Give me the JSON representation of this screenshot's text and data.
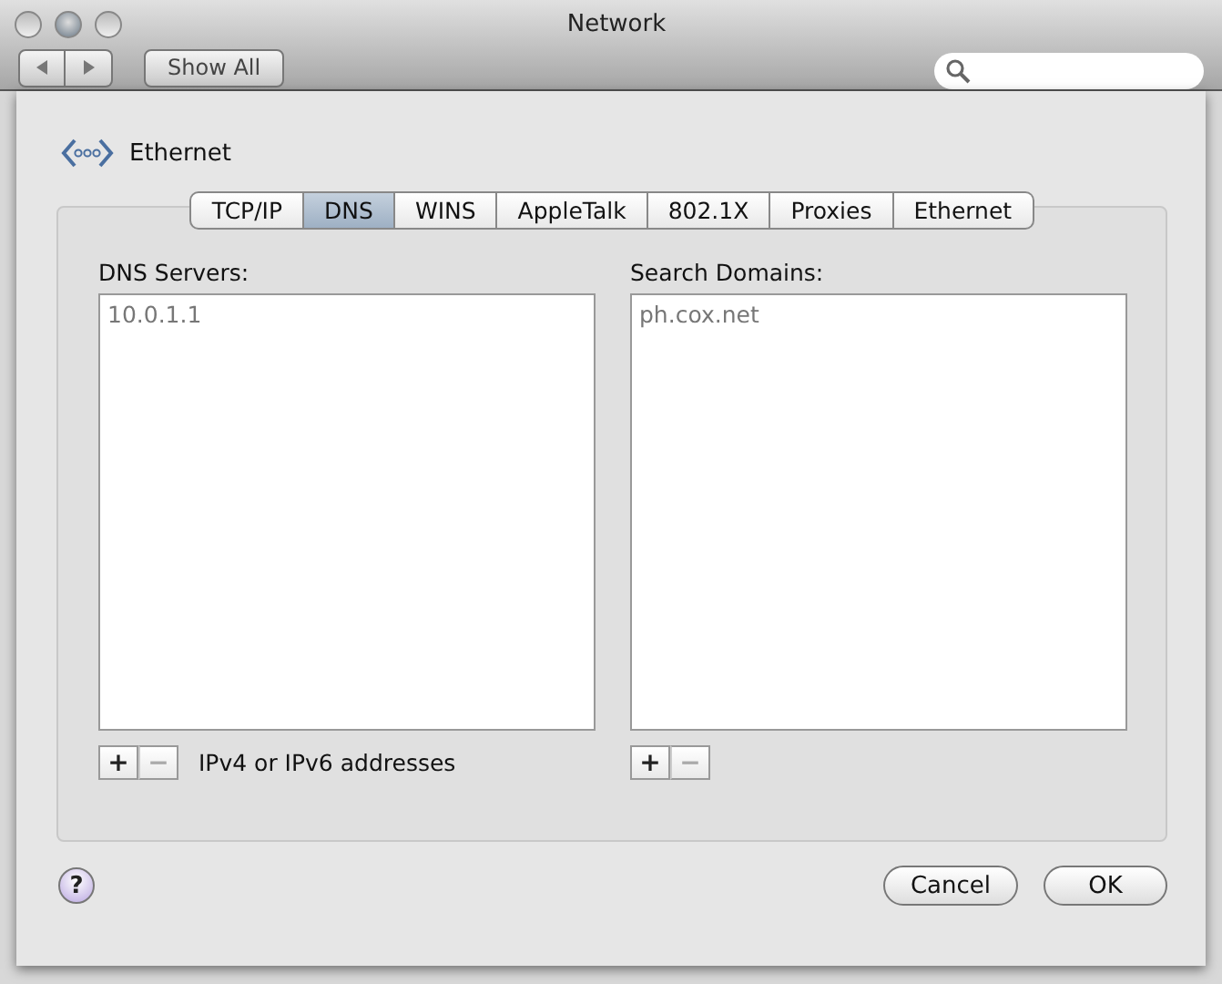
{
  "window": {
    "title": "Network"
  },
  "toolbar": {
    "show_all": "Show All"
  },
  "service": {
    "name": "Ethernet"
  },
  "tabs": [
    {
      "label": "TCP/IP",
      "selected": false
    },
    {
      "label": "DNS",
      "selected": true
    },
    {
      "label": "WINS",
      "selected": false
    },
    {
      "label": "AppleTalk",
      "selected": false
    },
    {
      "label": "802.1X",
      "selected": false
    },
    {
      "label": "Proxies",
      "selected": false
    },
    {
      "label": "Ethernet",
      "selected": false
    }
  ],
  "lists": [
    {
      "label": "DNS Servers:",
      "entries": [
        "10.0.1.1"
      ],
      "add": {
        "label": "+",
        "disabled": false
      },
      "remove": {
        "label": "−",
        "disabled": true
      },
      "hint": "IPv4 or IPv6 addresses"
    },
    {
      "label": "Search Domains:",
      "entries": [
        "ph.cox.net"
      ],
      "add": {
        "label": "+",
        "disabled": false
      },
      "remove": {
        "label": "−",
        "disabled": true
      }
    }
  ],
  "help": "?",
  "buttons": [
    {
      "label": "Cancel",
      "default": false
    },
    {
      "label": "OK",
      "default": false
    }
  ]
}
